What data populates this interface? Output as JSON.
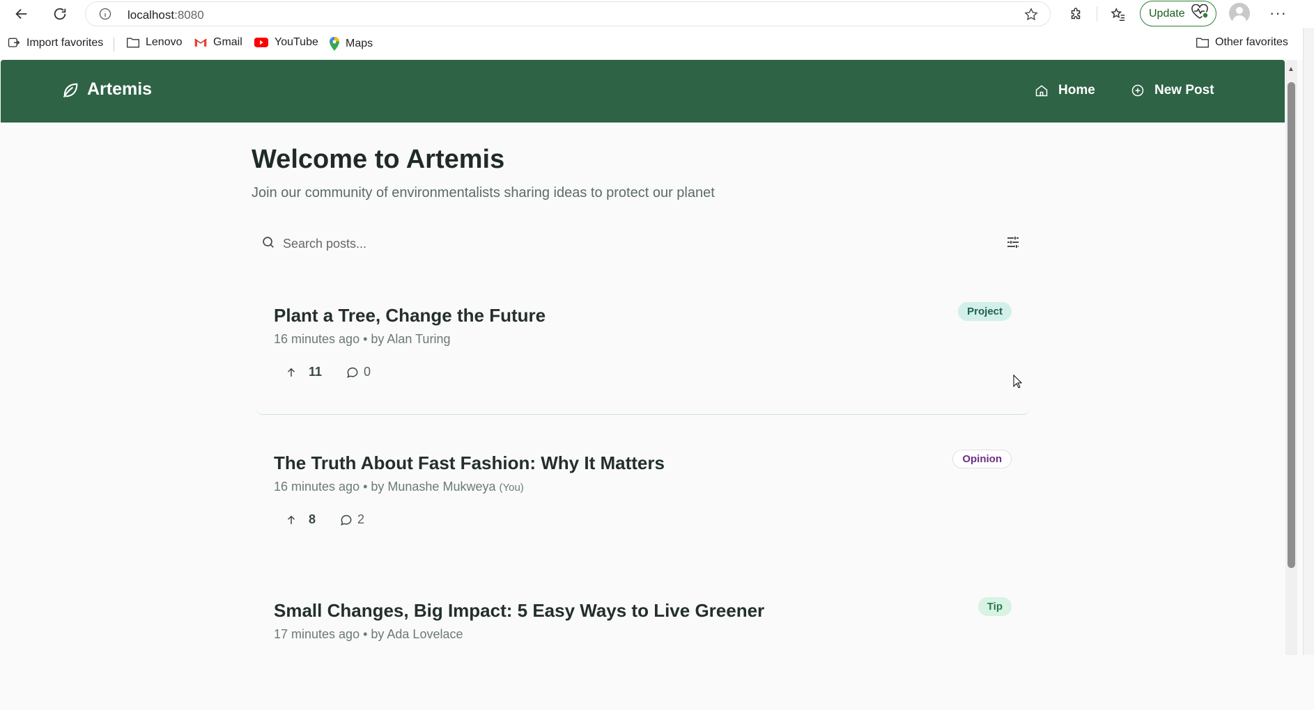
{
  "browser": {
    "url_host": "localhost",
    "url_port": ":8080",
    "update_label": "Update",
    "bookmarks": [
      {
        "label": "Import favorites",
        "icon": "import-icon"
      },
      {
        "label": "Lenovo",
        "icon": "folder-icon"
      },
      {
        "label": "Gmail",
        "icon": "gmail-icon"
      },
      {
        "label": "YouTube",
        "icon": "youtube-icon"
      },
      {
        "label": "Maps",
        "icon": "maps-icon"
      }
    ],
    "other_favorites": "Other favorites"
  },
  "app": {
    "brand": "Artemis",
    "nav": {
      "home": "Home",
      "new_post": "New Post"
    },
    "accent_color": "#2e6345"
  },
  "main": {
    "title": "Welcome to Artemis",
    "subtitle": "Join our community of environmentalists sharing ideas to protect our planet",
    "search_placeholder": "Search posts..."
  },
  "posts": [
    {
      "title": "Plant a Tree, Change the Future",
      "meta": "16 minutes ago • by Alan Turing",
      "you": "",
      "tag": "Project",
      "upvotes": "11",
      "comments": "0"
    },
    {
      "title": "The Truth About Fast Fashion: Why It Matters",
      "meta": "16 minutes ago • by Munashe Mukweya",
      "you": "(You)",
      "tag": "Opinion",
      "upvotes": "8",
      "comments": "2"
    },
    {
      "title": "Small Changes, Big Impact: 5 Easy Ways to Live Greener",
      "meta": "17 minutes ago • by Ada Lovelace",
      "you": "",
      "tag": "Tip"
    }
  ]
}
